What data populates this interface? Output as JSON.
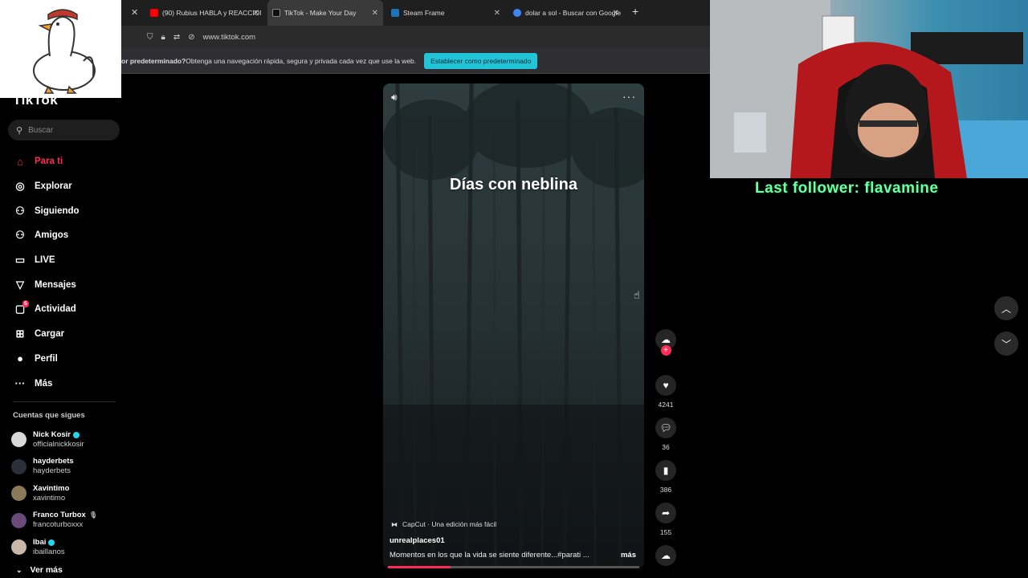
{
  "browser": {
    "tabs": [
      {
        "title": "(90) Rubius HABLA y REACCION",
        "favicon_color": "#ff0000"
      },
      {
        "title": "TikTok - Make Your Day",
        "favicon_color": "#111111",
        "active": true
      },
      {
        "title": "Steam Frame",
        "favicon_color": "#1b75bb"
      },
      {
        "title": "dolar a sol - Buscar con Google",
        "favicon_color": "#4285f4"
      }
    ],
    "close_glyph": "✕",
    "new_tab": "+",
    "url": "www.tiktok.com",
    "infobar_bold": "or predeterminado?",
    "infobar_text": " Obtenga una navegación rápida, segura y privada cada vez que use la web.",
    "infobar_button": "Establecer como predeterminado"
  },
  "sidebar": {
    "logo": "TikTok",
    "search_placeholder": "Buscar",
    "nav": [
      {
        "label": "Para ti",
        "icon": "home-icon",
        "glyph": "⌂",
        "active": true
      },
      {
        "label": "Explorar",
        "icon": "compass-icon",
        "glyph": "◎"
      },
      {
        "label": "Siguiendo",
        "icon": "following-icon",
        "glyph": "⚇"
      },
      {
        "label": "Amigos",
        "icon": "friends-icon",
        "glyph": "⚇"
      },
      {
        "label": "LIVE",
        "icon": "live-icon",
        "glyph": "▭"
      },
      {
        "label": "Mensajes",
        "icon": "messages-icon",
        "glyph": "▽"
      },
      {
        "label": "Actividad",
        "icon": "activity-icon",
        "glyph": "▢",
        "badge": "5"
      },
      {
        "label": "Cargar",
        "icon": "upload-icon",
        "glyph": "⊞"
      },
      {
        "label": "Perfil",
        "icon": "profile-icon",
        "glyph": "●"
      },
      {
        "label": "Más",
        "icon": "more-icon",
        "glyph": "···"
      }
    ],
    "following_title": "Cuentas que sigues",
    "following": [
      {
        "name": "Nick Kosir",
        "username": "officialnickkosir",
        "verified": true,
        "avatar_color": "#d9d9d9"
      },
      {
        "name": "hayderbets",
        "username": "hayderbets",
        "verified": false,
        "avatar_color": "#2b2f3a"
      },
      {
        "name": "Xavintimo",
        "username": "xavintimo",
        "verified": false,
        "avatar_color": "#8a7a5a"
      },
      {
        "name": "Franco Turbox",
        "username": "francoturboxxx",
        "verified": false,
        "mic": "🎙",
        "avatar_color": "#6a4a7a"
      },
      {
        "name": "Ibai",
        "username": "ibaillanos",
        "verified": true,
        "avatar_color": "#c9b8a8"
      }
    ],
    "see_more": "Ver más"
  },
  "video": {
    "caption": "Días con neblina",
    "capcut": "CapCut · Una edición más fácil",
    "author": "unrealplaces01",
    "description": "Momentos en los que la vida se siente diferente...#parati  ...",
    "more_link": "más",
    "progress": 0.25
  },
  "actions": {
    "likes": "4241",
    "comments": "36",
    "saves": "386",
    "shares": "155"
  },
  "stream": {
    "last_follower": "Last follower: flavamine"
  },
  "colors": {
    "accent": "#fe2c55",
    "follower_text": "#6dffa3",
    "infobar_button": "#22c4d8"
  }
}
